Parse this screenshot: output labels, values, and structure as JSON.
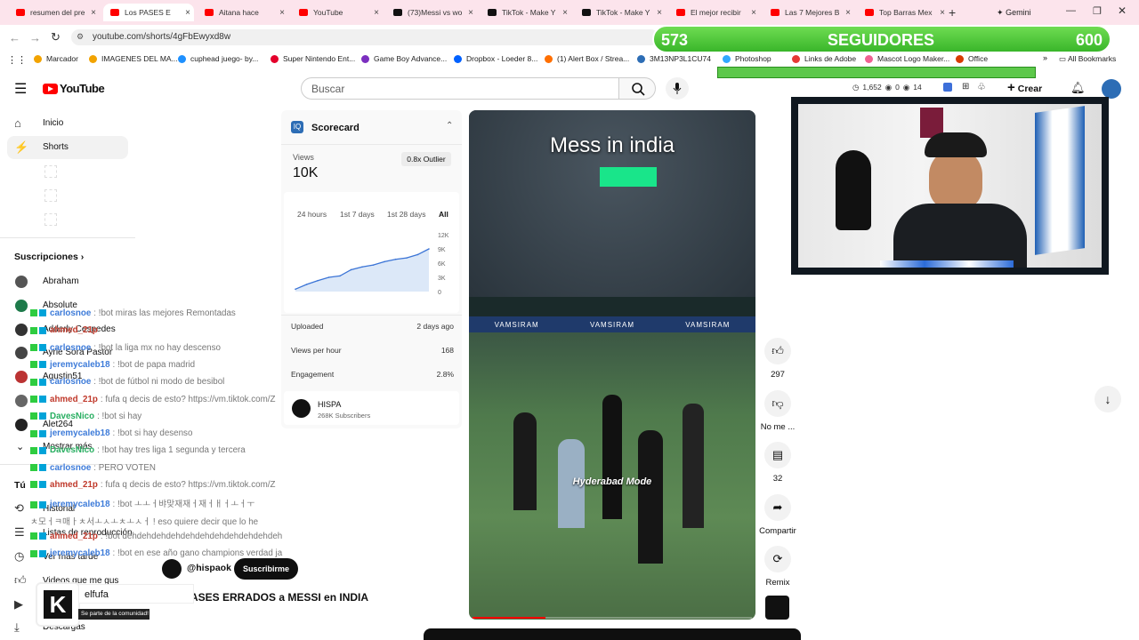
{
  "tabs": [
    {
      "label": "resumen del pre",
      "fav": "#ff0000"
    },
    {
      "label": "Los PASES E",
      "fav": "#ff0000"
    },
    {
      "label": "Aitana hace",
      "fav": "#ff0000"
    },
    {
      "label": "YouTube",
      "fav": "#ff0000"
    },
    {
      "label": "(73)Messi vs wo",
      "fav": "#111111"
    },
    {
      "label": "TikTok - Make Y",
      "fav": "#111111"
    },
    {
      "label": "TikTok - Make Y",
      "fav": "#111111"
    },
    {
      "label": "El mejor recibir",
      "fav": "#ff0000"
    },
    {
      "label": "Las 7 Mejores B",
      "fav": "#ff0000"
    },
    {
      "label": "Top Barras Mex",
      "fav": "#ff0000"
    }
  ],
  "new_tab": "+",
  "gemini": "Gemini",
  "url": "youtube.com/shorts/4gFbEwyxd8w",
  "bookmarks": [
    "Marcador",
    "IMAGENES DEL MA...",
    "cuphead juego- by...",
    "Super Nintendo Ent...",
    "Game Boy Advance...",
    "Dropbox - Loeder 8...",
    "(1) Alert Box / Strea...",
    "3M13NP3L1CU74",
    "Photoshop",
    "Links de Adobe",
    "Mascot Logo Maker...",
    "Office"
  ],
  "all_bookmarks": "All Bookmarks",
  "followers": {
    "current": "573",
    "label": "SEGUIDORES",
    "goal": "600"
  },
  "yt": {
    "logo": "YouTube",
    "search_placeholder": "Buscar",
    "create": "Crear",
    "stats": [
      "1,652",
      "0",
      "14"
    ]
  },
  "sidebar": {
    "inicio": "Inicio",
    "shorts": "Shorts",
    "suscripciones": "Suscripciones",
    "subs": [
      "Abraham",
      "Absolute",
      "Adderly Cespedes",
      "Ayrie Sora Pastor",
      "Agustin51",
      "",
      "Alet264"
    ],
    "mostrar_mas": "Mostrar más",
    "tu": "Tú",
    "historial": "Historial",
    "listas": "Listas de reproducción",
    "ver_mas_tarde": "Ver más tarde",
    "videos_gusta": "Videos que me gus",
    "descargas": "Descargas"
  },
  "scorecard": {
    "title": "Scorecard",
    "views_label": "Views",
    "views_value": "10K",
    "outlier": "0.8x Outlier",
    "tabs": [
      "24 hours",
      "1st 7 days",
      "1st 28 days",
      "All"
    ],
    "y_ticks": [
      "12K",
      "9K",
      "6K",
      "3K",
      "0"
    ],
    "uploaded_label": "Uploaded",
    "uploaded_value": "2 days ago",
    "vph_label": "Views per hour",
    "vph_value": "168",
    "engagement_label": "Engagement",
    "engagement_value": "2.8%",
    "channel_name": "HISPA",
    "channel_subs": "268K Subscribers"
  },
  "chart_data": {
    "type": "area",
    "x": [
      0,
      1,
      2,
      3,
      4,
      5,
      6,
      7,
      8,
      9,
      10,
      11,
      12
    ],
    "values": [
      500,
      1500,
      2300,
      3000,
      3300,
      4600,
      5200,
      5600,
      6300,
      6800,
      7100,
      7800,
      9000
    ],
    "ylim": [
      0,
      12000
    ],
    "y_ticks": [
      0,
      3000,
      6000,
      9000,
      12000
    ]
  },
  "video": {
    "caption_top": "Mess in india",
    "caption_mid": "Hyderabad Mode",
    "banner_words": [
      "VAMSIRAM",
      "VAMSIRAM",
      "VAMSIRAM"
    ]
  },
  "channel": {
    "handle": "@hispaok",
    "subscribe": "Suscribirme",
    "title": "ASES ERRADOS a MESSI en INDIA"
  },
  "actions": {
    "likes": "297",
    "dislike": "No me ...",
    "comments": "32",
    "share": "Compartir",
    "remix": "Remix"
  },
  "chat": [
    {
      "user": "carlosnoe",
      "color": "#3d7bd9",
      "msg": ": !bot miras las mejores Remontadas"
    },
    {
      "user": "ahmed_21p",
      "color": "#c0392b",
      "msg": ""
    },
    {
      "user": "carlosnoe",
      "color": "#3d7bd9",
      "msg": ": !bot la liga mx no hay descenso"
    },
    {
      "user": "jeremycaleb18",
      "color": "#3d7bd9",
      "msg": ": !bot de papa madrid"
    },
    {
      "user": "carlosnoe",
      "color": "#3d7bd9",
      "msg": ": !bot de fútbol ni modo de besibol"
    },
    {
      "user": "ahmed_21p",
      "color": "#c0392b",
      "msg": ": fufa q decis de esto? https://vm.tiktok.com/Z"
    },
    {
      "user": "DavesNico",
      "color": "#27ae60",
      "msg": ": !bot si hay"
    },
    {
      "user": "jeremycaleb18",
      "color": "#3d7bd9",
      "msg": ": !bot si hay desenso"
    },
    {
      "user": "DavesNico",
      "color": "#27ae60",
      "msg": ": !bot hay tres liga 1 segunda y tercera"
    },
    {
      "user": "carlosnoe",
      "color": "#3d7bd9",
      "msg": ": PERO VOTEN"
    },
    {
      "user": "ahmed_21p",
      "color": "#c0392b",
      "msg": ": fufa q decis de esto? https://vm.tiktok.com/Z"
    },
    {
      "user": "jeremycaleb18",
      "color": "#3d7bd9",
      "msg": ": !bot ㅗㅗㅓ뱌맞재재ㅓ재ㅓㅐㅓㅗㅓㅜ"
    },
    {
      "user": "",
      "color": "#777",
      "msg": "ㅊ모ㅓㅋ매ㅏㅊ서ㅗㅅㅗㅊㅗㅅㅓ ! eso quiere decir que lo he"
    },
    {
      "user": "ahmed_21p",
      "color": "#c0392b",
      "msg": ": !bot dehdehdehdehdehdehdehdehdehdehdeh"
    },
    {
      "user": "jeremycaleb18",
      "color": "#3d7bd9",
      "msg": ": !bot en ese año gano champions verdad ja"
    }
  ],
  "stream_user": {
    "name": "elfufa",
    "sub": "Se parte de la comunidad!"
  }
}
